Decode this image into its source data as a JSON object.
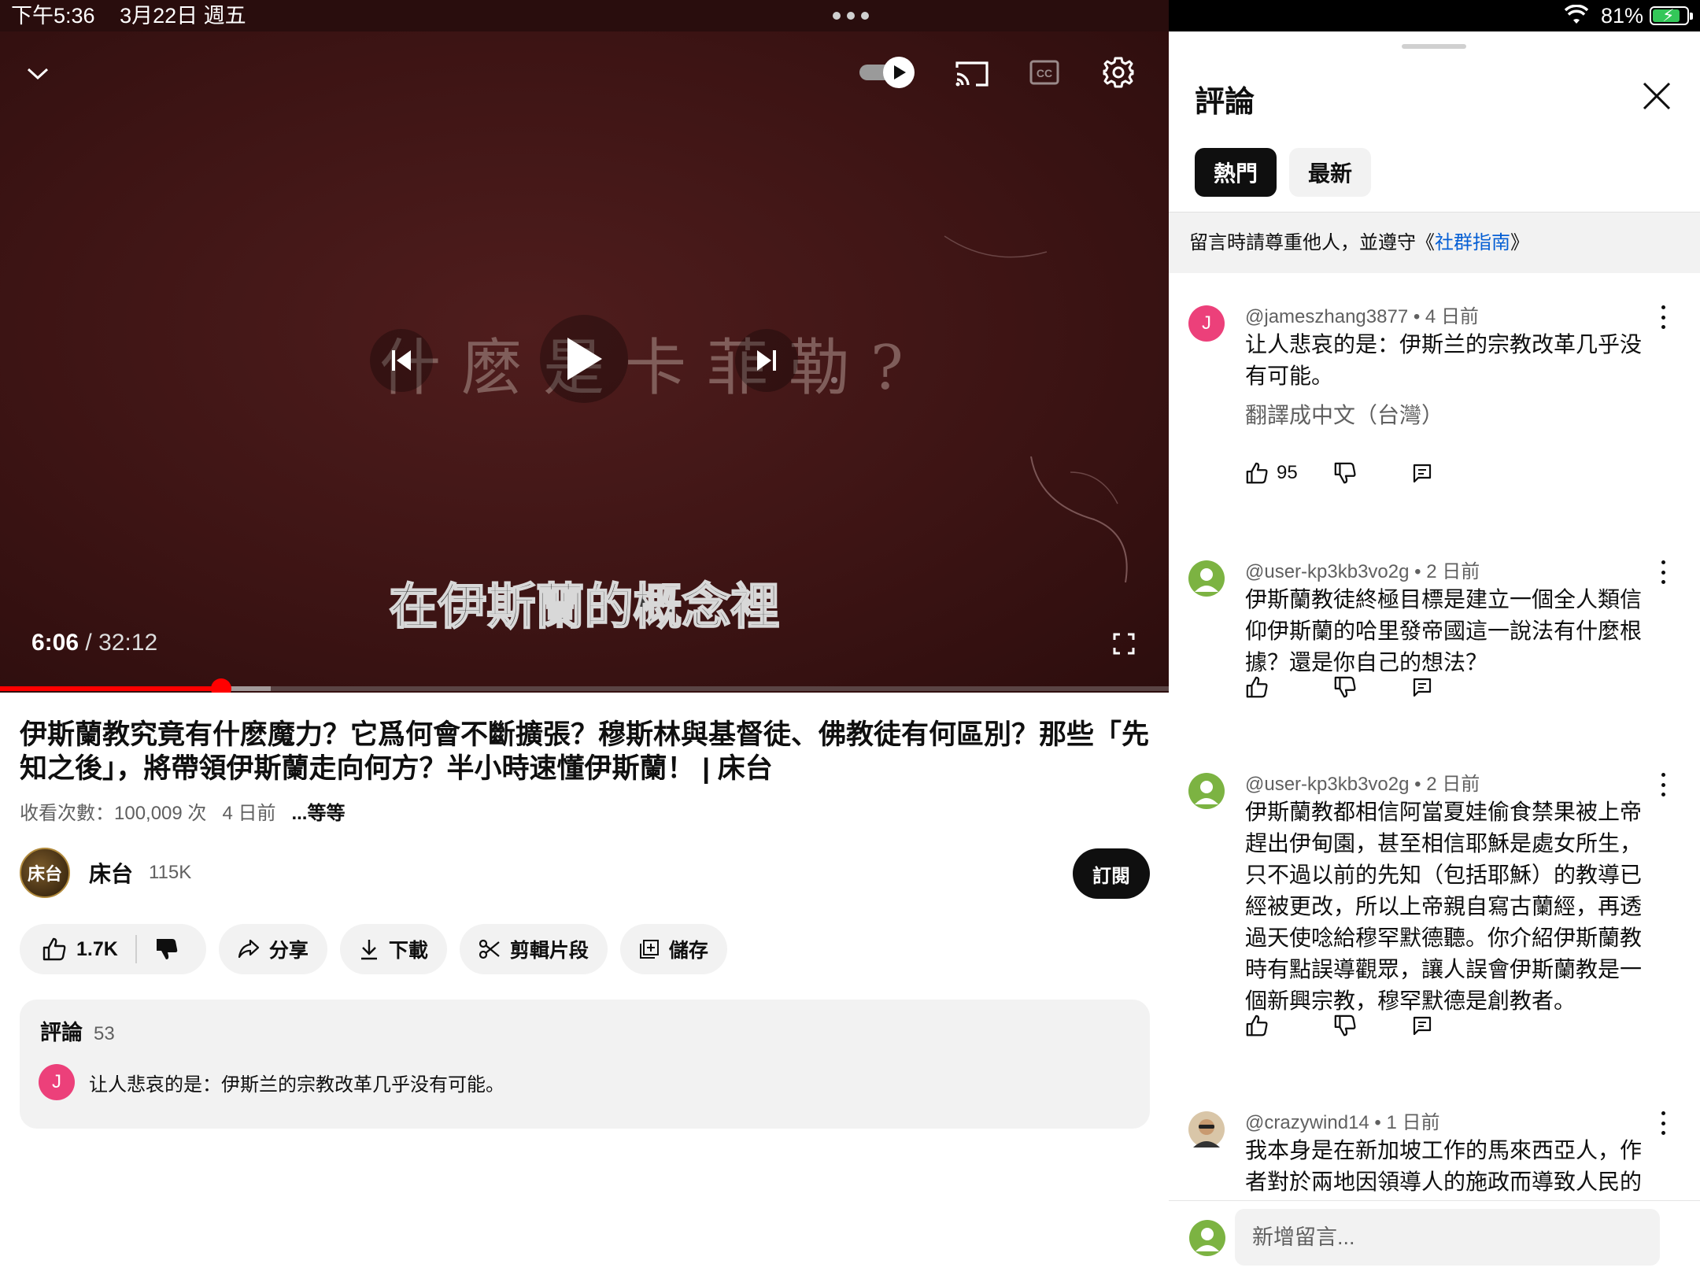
{
  "status_bar": {
    "time": "下午5:36",
    "date": "3月22日 週五",
    "battery": "81%",
    "battery_level": 0.81
  },
  "player": {
    "overlay_title": "什麽是卡菲勒?",
    "subtitle": "在伊斯蘭的概念裡",
    "current_time": "6:06",
    "separator": " / ",
    "duration": "32:12",
    "progress": 0.1894,
    "buffered": 0.2315,
    "icons": [
      "chevron-down-icon",
      "autoplay-toggle-icon",
      "cast-icon",
      "captions-icon",
      "settings-icon",
      "previous-icon",
      "play-icon",
      "next-icon",
      "fullscreen-icon"
    ]
  },
  "video": {
    "title": "伊斯蘭教究竟有什麽魔力？它爲何會不斷擴張？穆斯林與基督徒、佛教徒有何區別？那些「先知之後」，將帶領伊斯蘭走向何方？半小時速懂伊斯蘭！ | 床台",
    "views": "收看次數：100,009 次",
    "age": "4 日前",
    "more": "...等等",
    "channel": {
      "logo_text": "床台",
      "name": "床台",
      "subscribers": "115K",
      "subscribe_label": "訂閱"
    },
    "actions": {
      "likes": "1.7K",
      "share": "分享",
      "download": "下載",
      "clip": "剪輯片段",
      "save": "儲存"
    }
  },
  "comments_card": {
    "label": "評論",
    "count": "53",
    "preview_avatar": "J",
    "preview_text": "让人悲哀的是：伊斯兰的宗教改革几乎没有可能。"
  },
  "panel": {
    "title": "評論",
    "chips": [
      "熱門",
      "最新"
    ],
    "notice_prefix": "留言時請尊重他人，並遵守《",
    "notice_link": "社群指南",
    "notice_suffix": "》",
    "comments": [
      {
        "avatar": "J",
        "handle": "@jameszhang3877",
        "age": "4 日前",
        "text": "让人悲哀的是：伊斯兰的宗教改革几乎没有可能。",
        "translate": "翻譯成中文（台灣）",
        "likes": "95"
      },
      {
        "avatar": "",
        "handle": "@user-kp3kb3vo2g",
        "age": "2 日前",
        "text": "伊斯蘭教徒終極目標是建立一個全人類信仰伊斯蘭的哈里發帝國這一說法有什麼根據？還是你自己的想法？",
        "likes": ""
      },
      {
        "avatar": "",
        "handle": "@user-kp3kb3vo2g",
        "age": "2 日前",
        "text": "伊斯蘭教都相信阿當夏娃偷食禁果被上帝趕出伊甸園，甚至相信耶穌是處女所生，只不過以前的先知（包括耶穌）的教導已經被更改，所以上帝親自寫古蘭經，再透過天使唸給穆罕默德聽。你介紹伊斯蘭教時有點誤導觀眾，讓人誤會伊斯蘭教是一個新興宗教，穆罕默德是創教者。",
        "likes": ""
      },
      {
        "avatar": "",
        "handle": "@crazywind14",
        "age": "1 日前",
        "text": "我本身是在新加坡工作的馬來西亞人，作者對於兩地因領導人的施政而導致人民的",
        "likes": ""
      }
    ],
    "add_comment_placeholder": "新增留言..."
  },
  "colors": {
    "accent": "#ff0000",
    "link": "#065fd4",
    "player_bg": "#3d1414",
    "chip_active": "#0f0f0f"
  }
}
